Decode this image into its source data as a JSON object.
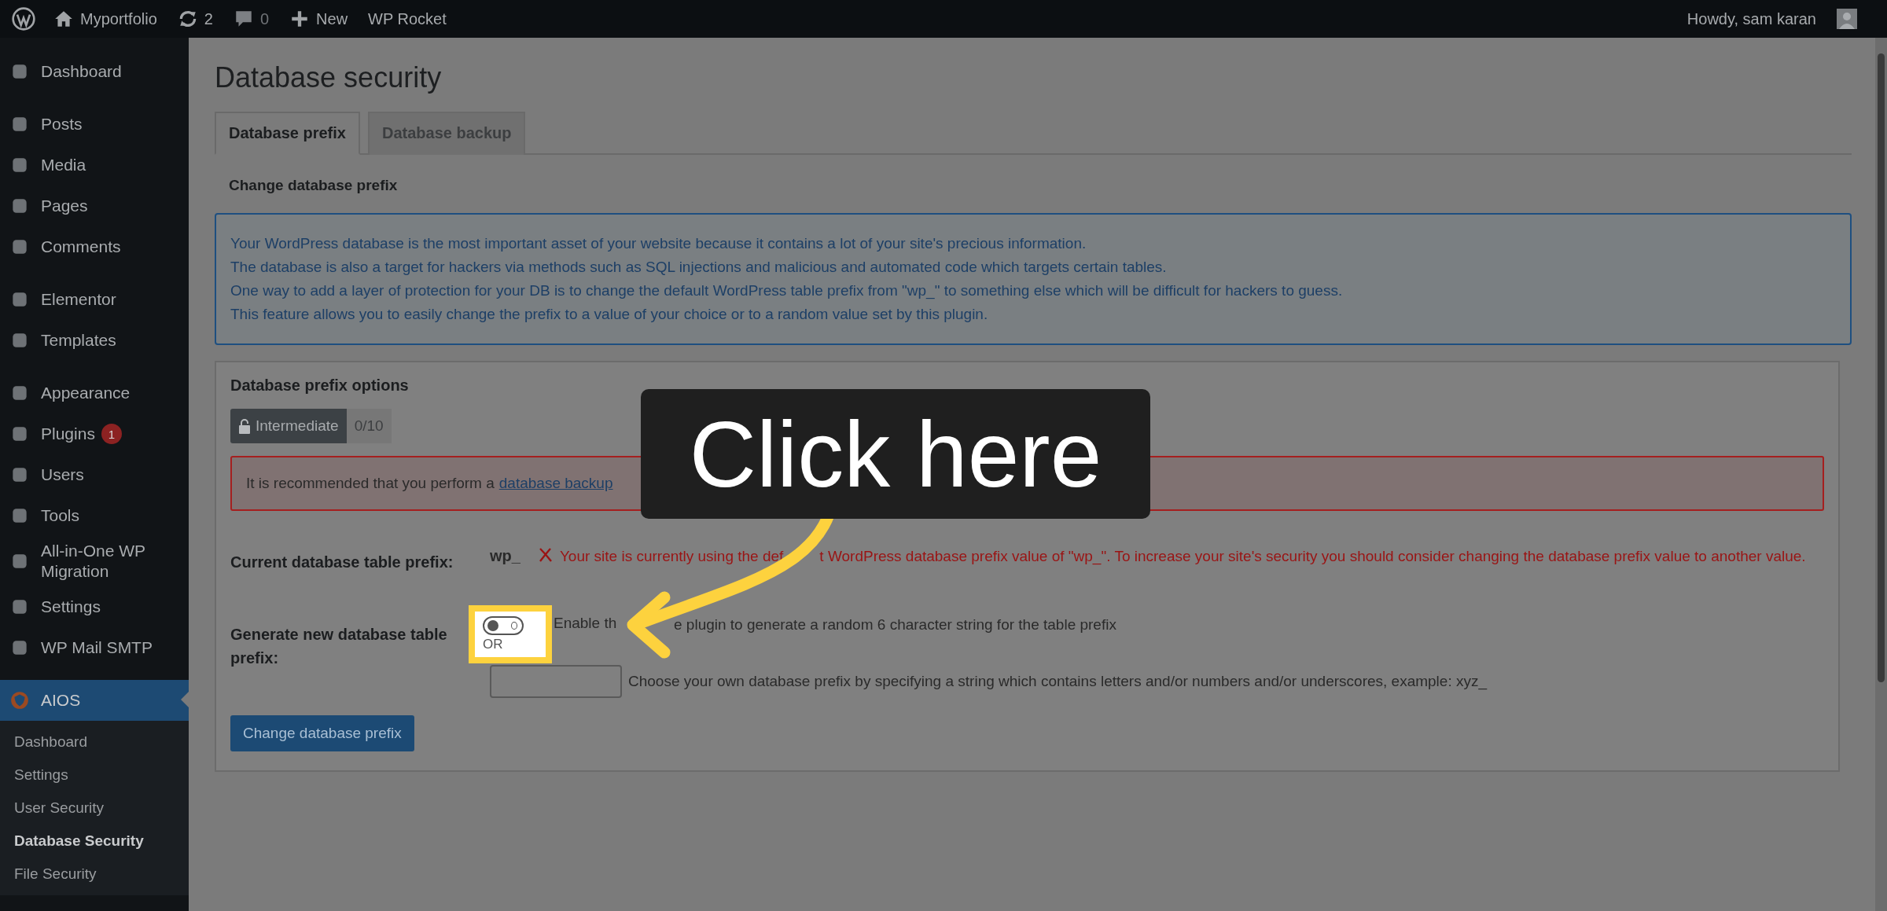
{
  "topbar": {
    "site": "Myportfolio",
    "updates": "2",
    "comments": "0",
    "new": "New",
    "plugin": "WP Rocket",
    "greeting": "Howdy, sam karan"
  },
  "sidebar": {
    "groups": [
      [
        {
          "label": "Dashboard"
        }
      ],
      [
        {
          "label": "Posts"
        },
        {
          "label": "Media"
        },
        {
          "label": "Pages"
        },
        {
          "label": "Comments"
        }
      ],
      [
        {
          "label": "Elementor"
        },
        {
          "label": "Templates"
        }
      ],
      [
        {
          "label": "Appearance"
        },
        {
          "label": "Plugins",
          "badge": "1"
        },
        {
          "label": "Users"
        },
        {
          "label": "Tools"
        },
        {
          "label": "All-in-One WP Migration"
        },
        {
          "label": "Settings"
        },
        {
          "label": "WP Mail SMTP"
        }
      ]
    ],
    "active": {
      "label": "AIOS"
    },
    "submenu": [
      {
        "label": "Dashboard",
        "selected": false
      },
      {
        "label": "Settings",
        "selected": false
      },
      {
        "label": "User Security",
        "selected": false
      },
      {
        "label": "Database Security",
        "selected": true
      },
      {
        "label": "File Security",
        "selected": false
      }
    ]
  },
  "page_title": "Database security",
  "tabs": [
    {
      "label": "Database prefix",
      "selected": true
    },
    {
      "label": "Database backup",
      "selected": false
    }
  ],
  "section_title": "Change database prefix",
  "info_lines": [
    "Your WordPress database is the most important asset of your website because it contains a lot of your site's precious information.",
    "The database is also a target for hackers via methods such as SQL injections and malicious and automated code which targets certain tables.",
    "One way to add a layer of protection for your DB is to change the default WordPress table prefix from \"wp_\" to something else which will be difficult for hackers to guess.",
    "This feature allows you to easily change the prefix to a value of your choice or to a random value set by this plugin."
  ],
  "options": {
    "title": "Database prefix options",
    "badge": {
      "label": "Intermediate",
      "score": "0/10"
    },
    "notice": {
      "text": "It is recommended that you perform a",
      "link": "database backup"
    },
    "current": {
      "label": "Current database table prefix:",
      "value": "wp_",
      "warning_parts": [
        "Your site is currently using the def",
        "t WordPress database prefix value of \"wp_\". To increase your site's security you should consider changing the database prefix value to another value."
      ]
    },
    "generate": {
      "label": "Generate new database table prefix:",
      "toggle": {
        "on": false
      },
      "toggle_label_parts": [
        "Enable th",
        "e plugin to generate a random 6 character string for the table prefix"
      ],
      "or": "OR",
      "input_hint": "Choose your own database prefix by specifying a string which contains letters and/or numbers and/or underscores, example: xyz_"
    },
    "button": "Change database prefix"
  },
  "callout": {
    "text": "Click here"
  }
}
